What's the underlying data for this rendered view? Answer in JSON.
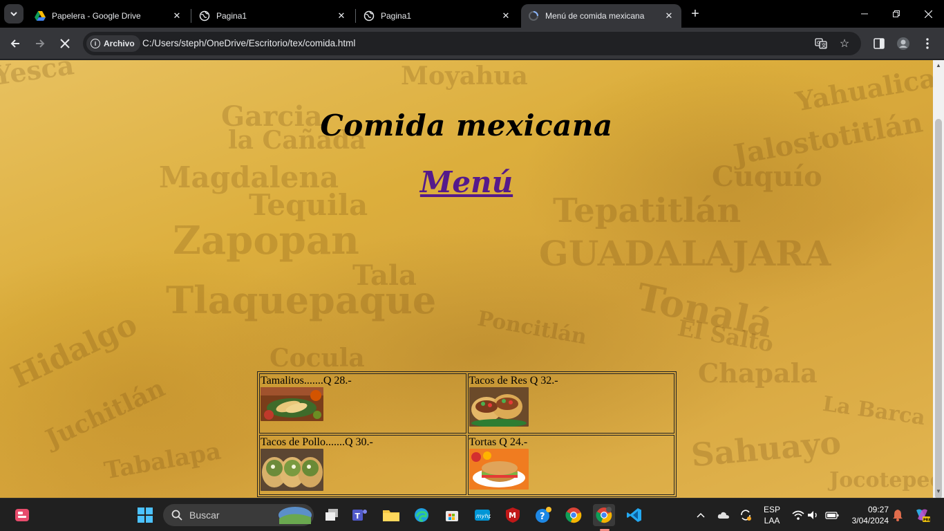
{
  "browser": {
    "tabs": [
      {
        "title": "Papelera - Google Drive",
        "icon": "google-drive-icon"
      },
      {
        "title": "Pagina1",
        "icon": "globe-icon"
      },
      {
        "title": "Pagina1",
        "icon": "globe-icon"
      },
      {
        "title": "Menú de comida mexicana",
        "icon": "loading-icon",
        "active": true
      }
    ],
    "security_chip": "Archivo",
    "url": "C:/Users/steph/OneDrive/Escritorio/tex/comida.html"
  },
  "page": {
    "title": "Comida mexicana",
    "menu_link": "Menú",
    "background_words": [
      "Yesca",
      "Moyahua",
      "Yahualica",
      "Garcia",
      "la Cañada",
      "Jalostotitlán",
      "Magdalena",
      "Cuquío",
      "Tequila",
      "Tepatitlán",
      "Zapopan",
      "GUADALAJARA",
      "Tala",
      "Tlaquepaque",
      "Tonalá",
      "El Salto",
      "Poncitlán",
      "Hidalgo",
      "Cocula",
      "Chapala",
      "Juchitlán",
      "Tabalapa",
      "Sahuayo",
      "La Barca",
      "Jocotepec"
    ],
    "menu_items": [
      {
        "label": "Tamalitos.......Q 28.-",
        "image": "tamales-photo"
      },
      {
        "label": "Tacos de Res Q 32.-",
        "image": "beef-tacos-photo"
      },
      {
        "label": "Tacos de Pollo.......Q 30.-",
        "image": "chicken-tacos-photo"
      },
      {
        "label": "Tortas Q 24.-",
        "image": "torta-photo"
      }
    ]
  },
  "taskbar": {
    "search_placeholder": "Buscar",
    "language": "ESP",
    "layout": "LAA",
    "time": "09:27",
    "date": "3/04/2024"
  },
  "colors": {
    "link": "#551a8b",
    "tabstrip": "#000000",
    "toolbar": "#35363a"
  }
}
